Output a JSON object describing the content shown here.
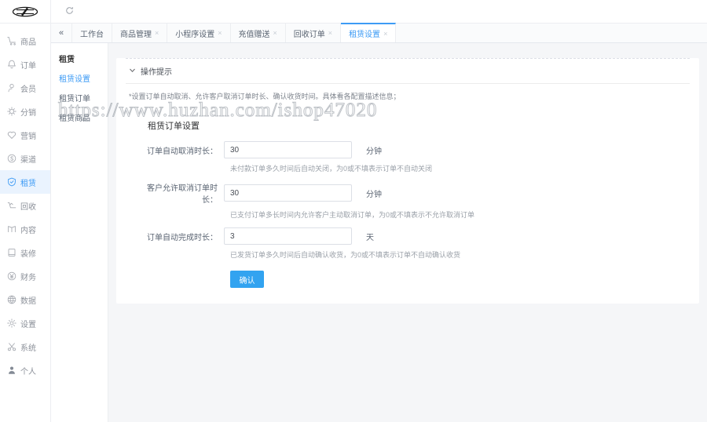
{
  "brand": {
    "logo_icon": "ellipse-logo",
    "accent": "#3d9bf5",
    "button_color": "#32a3f0",
    "active_bg": "#eaf3fe"
  },
  "topbar": {
    "refresh_icon": "refresh-icon"
  },
  "sidebar": {
    "items": [
      {
        "label": "商品",
        "icon": "cart-icon",
        "active": false
      },
      {
        "label": "订单",
        "icon": "bell-icon",
        "active": false
      },
      {
        "label": "会员",
        "icon": "user-icon",
        "active": false
      },
      {
        "label": "分销",
        "icon": "share-icon",
        "active": false
      },
      {
        "label": "营销",
        "icon": "heart-icon",
        "active": false
      },
      {
        "label": "渠道",
        "icon": "coin-icon",
        "active": false
      },
      {
        "label": "租赁",
        "icon": "shield-check-icon",
        "active": true
      },
      {
        "label": "回收",
        "icon": "recycle-icon",
        "active": false
      },
      {
        "label": "内容",
        "icon": "book-icon",
        "active": false
      },
      {
        "label": "装修",
        "icon": "layout-icon",
        "active": false
      },
      {
        "label": "财务",
        "icon": "yen-icon",
        "active": false
      },
      {
        "label": "数据",
        "icon": "globe-icon",
        "active": false
      },
      {
        "label": "设置",
        "icon": "gear-icon",
        "active": false
      },
      {
        "label": "系统",
        "icon": "scissors-icon",
        "active": false
      },
      {
        "label": "个人",
        "icon": "person-icon",
        "active": false
      }
    ]
  },
  "tabs": {
    "collapse_icon": "double-chevron-left-icon",
    "items": [
      {
        "label": "工作台",
        "closable": false,
        "active": false
      },
      {
        "label": "商品管理",
        "closable": true,
        "active": false
      },
      {
        "label": "小程序设置",
        "closable": true,
        "active": false
      },
      {
        "label": "充值赠送",
        "closable": true,
        "active": false
      },
      {
        "label": "回收订单",
        "closable": true,
        "active": false
      },
      {
        "label": "租赁设置",
        "closable": true,
        "active": true
      }
    ],
    "close_glyph": "×"
  },
  "submenu": {
    "title": "租赁",
    "items": [
      {
        "label": "租赁设置",
        "active": true
      },
      {
        "label": "租赁订单",
        "active": false
      },
      {
        "label": "租赁商品",
        "active": false
      }
    ]
  },
  "tip": {
    "icon": "chevron-down-icon",
    "title": "操作提示",
    "body": "*设置订单自动取消、允许客户取消订单时长、确认收货时间。具体看各配置描述信息；"
  },
  "form": {
    "section_title": "租赁订单设置",
    "fields": [
      {
        "label": "订单自动取消时长：",
        "value": "30",
        "placeholder": "",
        "unit": "分钟",
        "hint": "未付款订单多久时间后自动关闭，为0或不填表示订单不自动关闭"
      },
      {
        "label": "客户允许取消订单时长：",
        "value": "30",
        "placeholder": "",
        "unit": "分钟",
        "hint": "已支付订单多长时间内允许客户主动取消订单，为0或不填表示不允许取消订单"
      },
      {
        "label": "订单自动完成时长：",
        "value": "3",
        "placeholder": "",
        "unit": "天",
        "hint": "已发货订单多久时间后自动确认收货，为0或不填表示订单不自动确认收货"
      }
    ],
    "submit_label": "确认"
  },
  "watermark": {
    "text": "https://www.huzhan.com/ishop47020"
  }
}
